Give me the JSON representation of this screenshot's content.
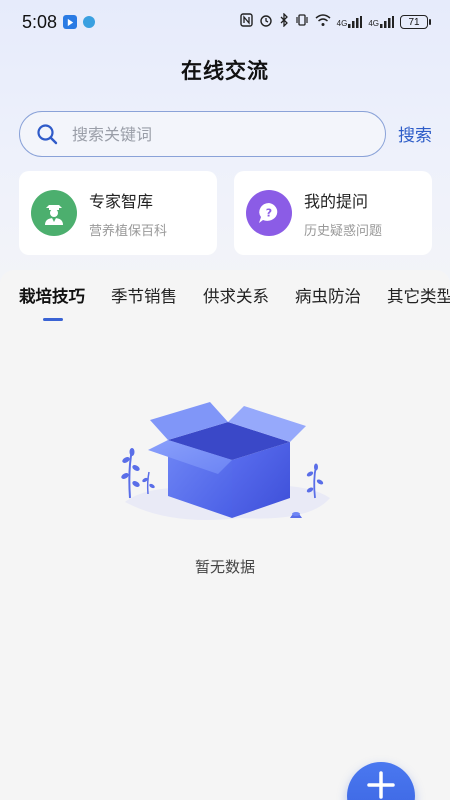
{
  "status_bar": {
    "time": "5:08",
    "battery": "71",
    "signal_1": "4G",
    "signal_2": "4G"
  },
  "header": {
    "title": "在线交流"
  },
  "search": {
    "placeholder": "搜索关键词",
    "value": "",
    "button_label": "搜索",
    "icon": "search-icon"
  },
  "cards": [
    {
      "title": "专家智库",
      "subtitle": "营养植保百科",
      "icon": "expert-icon",
      "color": "#4caf6e"
    },
    {
      "title": "我的提问",
      "subtitle": "历史疑惑问题",
      "icon": "question-chat-icon",
      "color": "#8b5ce6"
    }
  ],
  "tabs": [
    {
      "label": "栽培技巧",
      "active": true
    },
    {
      "label": "季节销售",
      "active": false
    },
    {
      "label": "供求关系",
      "active": false
    },
    {
      "label": "病虫防治",
      "active": false
    },
    {
      "label": "其它类型",
      "active": false
    }
  ],
  "empty_state": {
    "text": "暂无数据",
    "icon": "empty-box-icon"
  },
  "fab": {
    "icon": "plus-icon"
  },
  "colors": {
    "accent": "#3a63d4",
    "expert_green": "#4caf6e",
    "question_purple": "#8b5ce6"
  }
}
